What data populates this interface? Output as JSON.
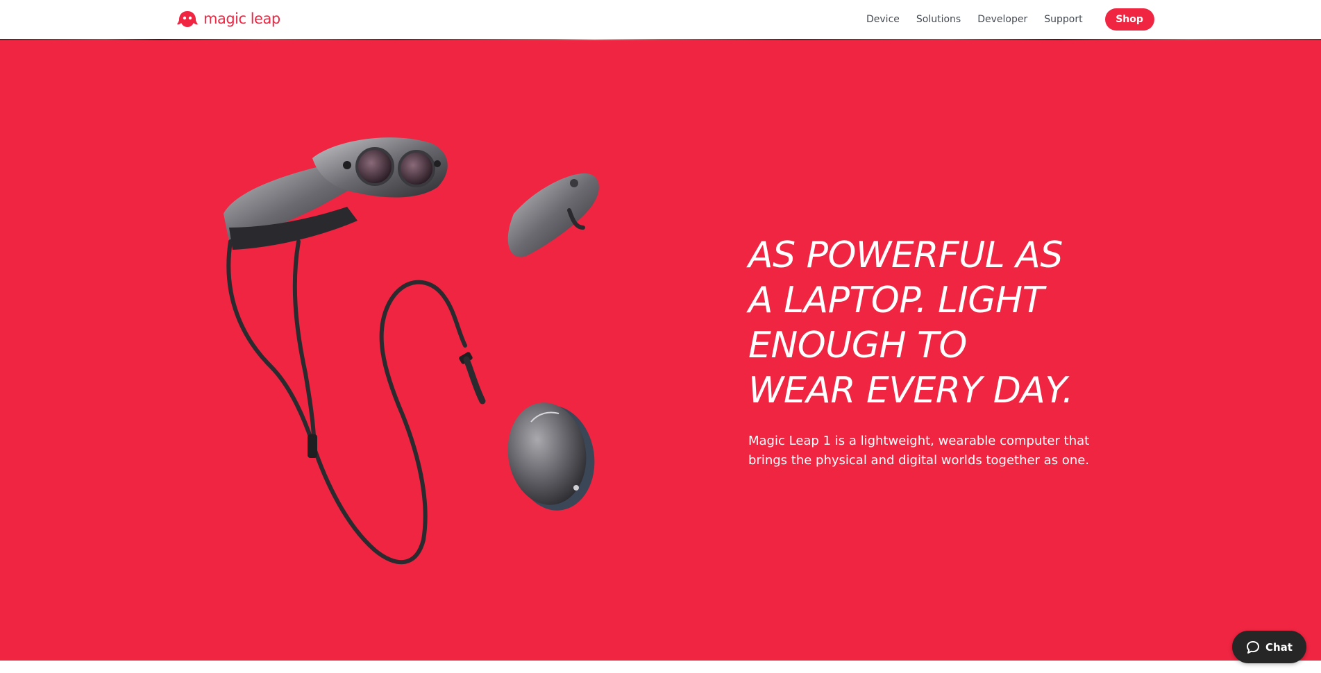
{
  "brand": {
    "name": "magic leap",
    "accent_color": "#ef2542"
  },
  "nav": {
    "items": [
      {
        "label": "Device",
        "icon": null
      },
      {
        "label": "Solutions",
        "icon": null
      },
      {
        "label": "Developer",
        "icon": null
      },
      {
        "label": "Support",
        "icon": null
      }
    ],
    "shop_label": "Shop"
  },
  "hero": {
    "background_color": "#ef2542",
    "title": "AS POWERFUL AS\nA LAPTOP. LIGHT\nENOUGH TO\nWEAR EVERY DAY.",
    "body": "Magic Leap 1 is a lightweight, wearable computer that\nbrings the physical and digital worlds together as one.",
    "image_icon": "product-headset-lightpack-controller"
  },
  "chat": {
    "label": "Chat",
    "icon": "chat-bubble-icon"
  }
}
